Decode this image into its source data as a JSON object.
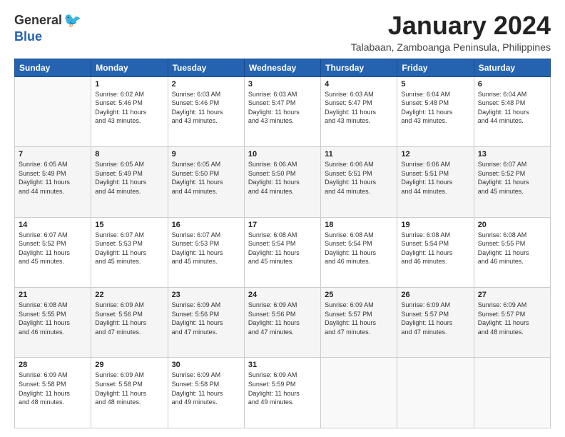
{
  "logo": {
    "general": "General",
    "blue": "Blue"
  },
  "title": "January 2024",
  "subtitle": "Talabaan, Zamboanga Peninsula, Philippines",
  "headers": [
    "Sunday",
    "Monday",
    "Tuesday",
    "Wednesday",
    "Thursday",
    "Friday",
    "Saturday"
  ],
  "weeks": [
    [
      {
        "day": "",
        "info": ""
      },
      {
        "day": "1",
        "info": "Sunrise: 6:02 AM\nSunset: 5:46 PM\nDaylight: 11 hours\nand 43 minutes."
      },
      {
        "day": "2",
        "info": "Sunrise: 6:03 AM\nSunset: 5:46 PM\nDaylight: 11 hours\nand 43 minutes."
      },
      {
        "day": "3",
        "info": "Sunrise: 6:03 AM\nSunset: 5:47 PM\nDaylight: 11 hours\nand 43 minutes."
      },
      {
        "day": "4",
        "info": "Sunrise: 6:03 AM\nSunset: 5:47 PM\nDaylight: 11 hours\nand 43 minutes."
      },
      {
        "day": "5",
        "info": "Sunrise: 6:04 AM\nSunset: 5:48 PM\nDaylight: 11 hours\nand 43 minutes."
      },
      {
        "day": "6",
        "info": "Sunrise: 6:04 AM\nSunset: 5:48 PM\nDaylight: 11 hours\nand 44 minutes."
      }
    ],
    [
      {
        "day": "7",
        "info": "Sunrise: 6:05 AM\nSunset: 5:49 PM\nDaylight: 11 hours\nand 44 minutes."
      },
      {
        "day": "8",
        "info": "Sunrise: 6:05 AM\nSunset: 5:49 PM\nDaylight: 11 hours\nand 44 minutes."
      },
      {
        "day": "9",
        "info": "Sunrise: 6:05 AM\nSunset: 5:50 PM\nDaylight: 11 hours\nand 44 minutes."
      },
      {
        "day": "10",
        "info": "Sunrise: 6:06 AM\nSunset: 5:50 PM\nDaylight: 11 hours\nand 44 minutes."
      },
      {
        "day": "11",
        "info": "Sunrise: 6:06 AM\nSunset: 5:51 PM\nDaylight: 11 hours\nand 44 minutes."
      },
      {
        "day": "12",
        "info": "Sunrise: 6:06 AM\nSunset: 5:51 PM\nDaylight: 11 hours\nand 44 minutes."
      },
      {
        "day": "13",
        "info": "Sunrise: 6:07 AM\nSunset: 5:52 PM\nDaylight: 11 hours\nand 45 minutes."
      }
    ],
    [
      {
        "day": "14",
        "info": "Sunrise: 6:07 AM\nSunset: 5:52 PM\nDaylight: 11 hours\nand 45 minutes."
      },
      {
        "day": "15",
        "info": "Sunrise: 6:07 AM\nSunset: 5:53 PM\nDaylight: 11 hours\nand 45 minutes."
      },
      {
        "day": "16",
        "info": "Sunrise: 6:07 AM\nSunset: 5:53 PM\nDaylight: 11 hours\nand 45 minutes."
      },
      {
        "day": "17",
        "info": "Sunrise: 6:08 AM\nSunset: 5:54 PM\nDaylight: 11 hours\nand 45 minutes."
      },
      {
        "day": "18",
        "info": "Sunrise: 6:08 AM\nSunset: 5:54 PM\nDaylight: 11 hours\nand 46 minutes."
      },
      {
        "day": "19",
        "info": "Sunrise: 6:08 AM\nSunset: 5:54 PM\nDaylight: 11 hours\nand 46 minutes."
      },
      {
        "day": "20",
        "info": "Sunrise: 6:08 AM\nSunset: 5:55 PM\nDaylight: 11 hours\nand 46 minutes."
      }
    ],
    [
      {
        "day": "21",
        "info": "Sunrise: 6:08 AM\nSunset: 5:55 PM\nDaylight: 11 hours\nand 46 minutes."
      },
      {
        "day": "22",
        "info": "Sunrise: 6:09 AM\nSunset: 5:56 PM\nDaylight: 11 hours\nand 47 minutes."
      },
      {
        "day": "23",
        "info": "Sunrise: 6:09 AM\nSunset: 5:56 PM\nDaylight: 11 hours\nand 47 minutes."
      },
      {
        "day": "24",
        "info": "Sunrise: 6:09 AM\nSunset: 5:56 PM\nDaylight: 11 hours\nand 47 minutes."
      },
      {
        "day": "25",
        "info": "Sunrise: 6:09 AM\nSunset: 5:57 PM\nDaylight: 11 hours\nand 47 minutes."
      },
      {
        "day": "26",
        "info": "Sunrise: 6:09 AM\nSunset: 5:57 PM\nDaylight: 11 hours\nand 47 minutes."
      },
      {
        "day": "27",
        "info": "Sunrise: 6:09 AM\nSunset: 5:57 PM\nDaylight: 11 hours\nand 48 minutes."
      }
    ],
    [
      {
        "day": "28",
        "info": "Sunrise: 6:09 AM\nSunset: 5:58 PM\nDaylight: 11 hours\nand 48 minutes."
      },
      {
        "day": "29",
        "info": "Sunrise: 6:09 AM\nSunset: 5:58 PM\nDaylight: 11 hours\nand 48 minutes."
      },
      {
        "day": "30",
        "info": "Sunrise: 6:09 AM\nSunset: 5:58 PM\nDaylight: 11 hours\nand 49 minutes."
      },
      {
        "day": "31",
        "info": "Sunrise: 6:09 AM\nSunset: 5:59 PM\nDaylight: 11 hours\nand 49 minutes."
      },
      {
        "day": "",
        "info": ""
      },
      {
        "day": "",
        "info": ""
      },
      {
        "day": "",
        "info": ""
      }
    ]
  ]
}
